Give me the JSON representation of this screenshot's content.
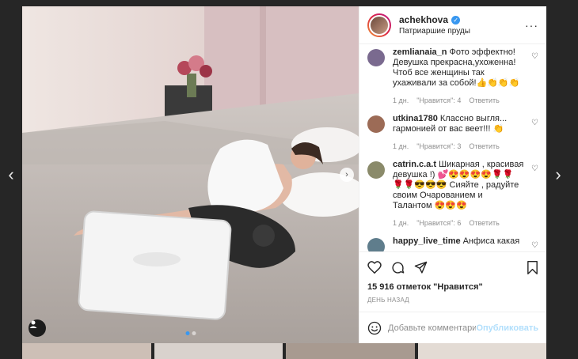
{
  "post": {
    "username": "achekhova",
    "location": "Патриаршие пруды",
    "likes": "15 916 отметок \"Нравится\"",
    "date": "ДЕНЬ НАЗАД"
  },
  "comments": [
    {
      "user": "zemlianaia_n",
      "text": "Фото эффектно! Девушка прекрасна,ухоженна! Чтоб все женщины так ухаживали за собой!👍👏👏👏",
      "time": "1 дн.",
      "likes": "\"Нравится\": 4",
      "reply": "Ответить"
    },
    {
      "user": "utkina1780",
      "text": "Классно выгля... гармонией от вас веет!!! 👏",
      "time": "1 дн.",
      "likes": "\"Нравится\": 3",
      "reply": "Ответить"
    },
    {
      "user": "catrin.c.a.t",
      "text": "Шикарная , красивая девушка !) 💕😍😍😍😍🌹🌹🌹🌹😎😎😎 Сияйте , радуйте своим Очарованием и Талантом 😍😍😍",
      "time": "1 дн.",
      "likes": "\"Нравится\": 6",
      "reply": "Ответить"
    },
    {
      "user": "happy_live_time",
      "text": "Анфиса какая ...",
      "time": "",
      "likes": "",
      "reply": ""
    }
  ],
  "add_comment": {
    "placeholder": "Добавьте комментарий...",
    "publish_label": "Опубликовать"
  },
  "colors": {
    "background": "#262626",
    "link_blue": "#3897f0",
    "publish_disabled": "#b2dffc",
    "meta_gray": "#8e8e8e"
  },
  "icons": [
    "chevron-left-icon",
    "chevron-right-icon",
    "verified-icon",
    "more-icon",
    "heart-icon",
    "comment-icon",
    "share-icon",
    "bookmark-icon",
    "emoji-icon",
    "user-tag-icon"
  ]
}
